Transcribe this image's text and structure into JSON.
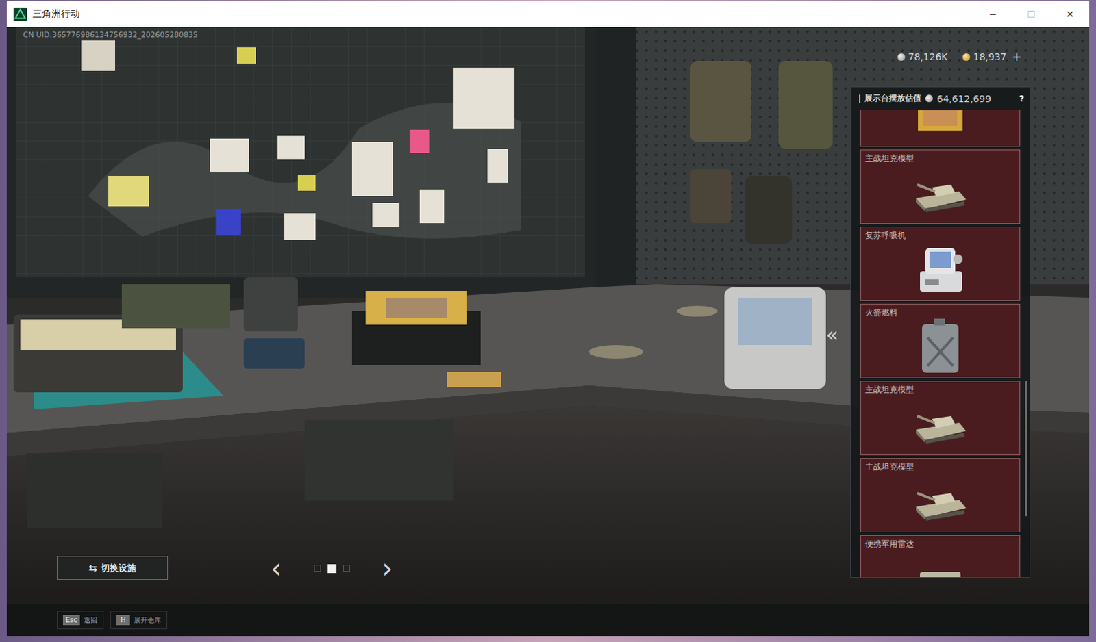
{
  "window": {
    "title": "三角洲行动",
    "controls": [
      "─",
      "☐",
      "✕"
    ]
  },
  "uid": "CN UID:365776986134756932_202605280835",
  "currencies": [
    {
      "value": "78,126K",
      "kind": "silver"
    },
    {
      "value": "18,937",
      "kind": "gold"
    }
  ],
  "add_button": "+",
  "display_panel": {
    "title": "展示台摆放估值",
    "value": "64,612,699",
    "help": "?",
    "collapse": "«",
    "items": [
      {
        "label": "",
        "kind": "painting"
      },
      {
        "label": "主战坦克模型",
        "kind": "tank"
      },
      {
        "label": "复苏呼吸机",
        "kind": "ventilator"
      },
      {
        "label": "火箭燃料",
        "kind": "fuel"
      },
      {
        "label": "主战坦克模型",
        "kind": "tank"
      },
      {
        "label": "主战坦克模型",
        "kind": "tank"
      },
      {
        "label": "便携军用雷达",
        "kind": "radar"
      }
    ]
  },
  "switch_button": {
    "label": "切换设施",
    "icon": "⇆"
  },
  "pager": {
    "prev": "‹",
    "next": "›",
    "pages": [
      {
        "selected": false
      },
      {
        "selected": true
      },
      {
        "selected": false
      }
    ]
  },
  "hints": [
    {
      "key": "Esc",
      "label": "返回"
    },
    {
      "key": "H",
      "label": "展开仓库"
    }
  ]
}
